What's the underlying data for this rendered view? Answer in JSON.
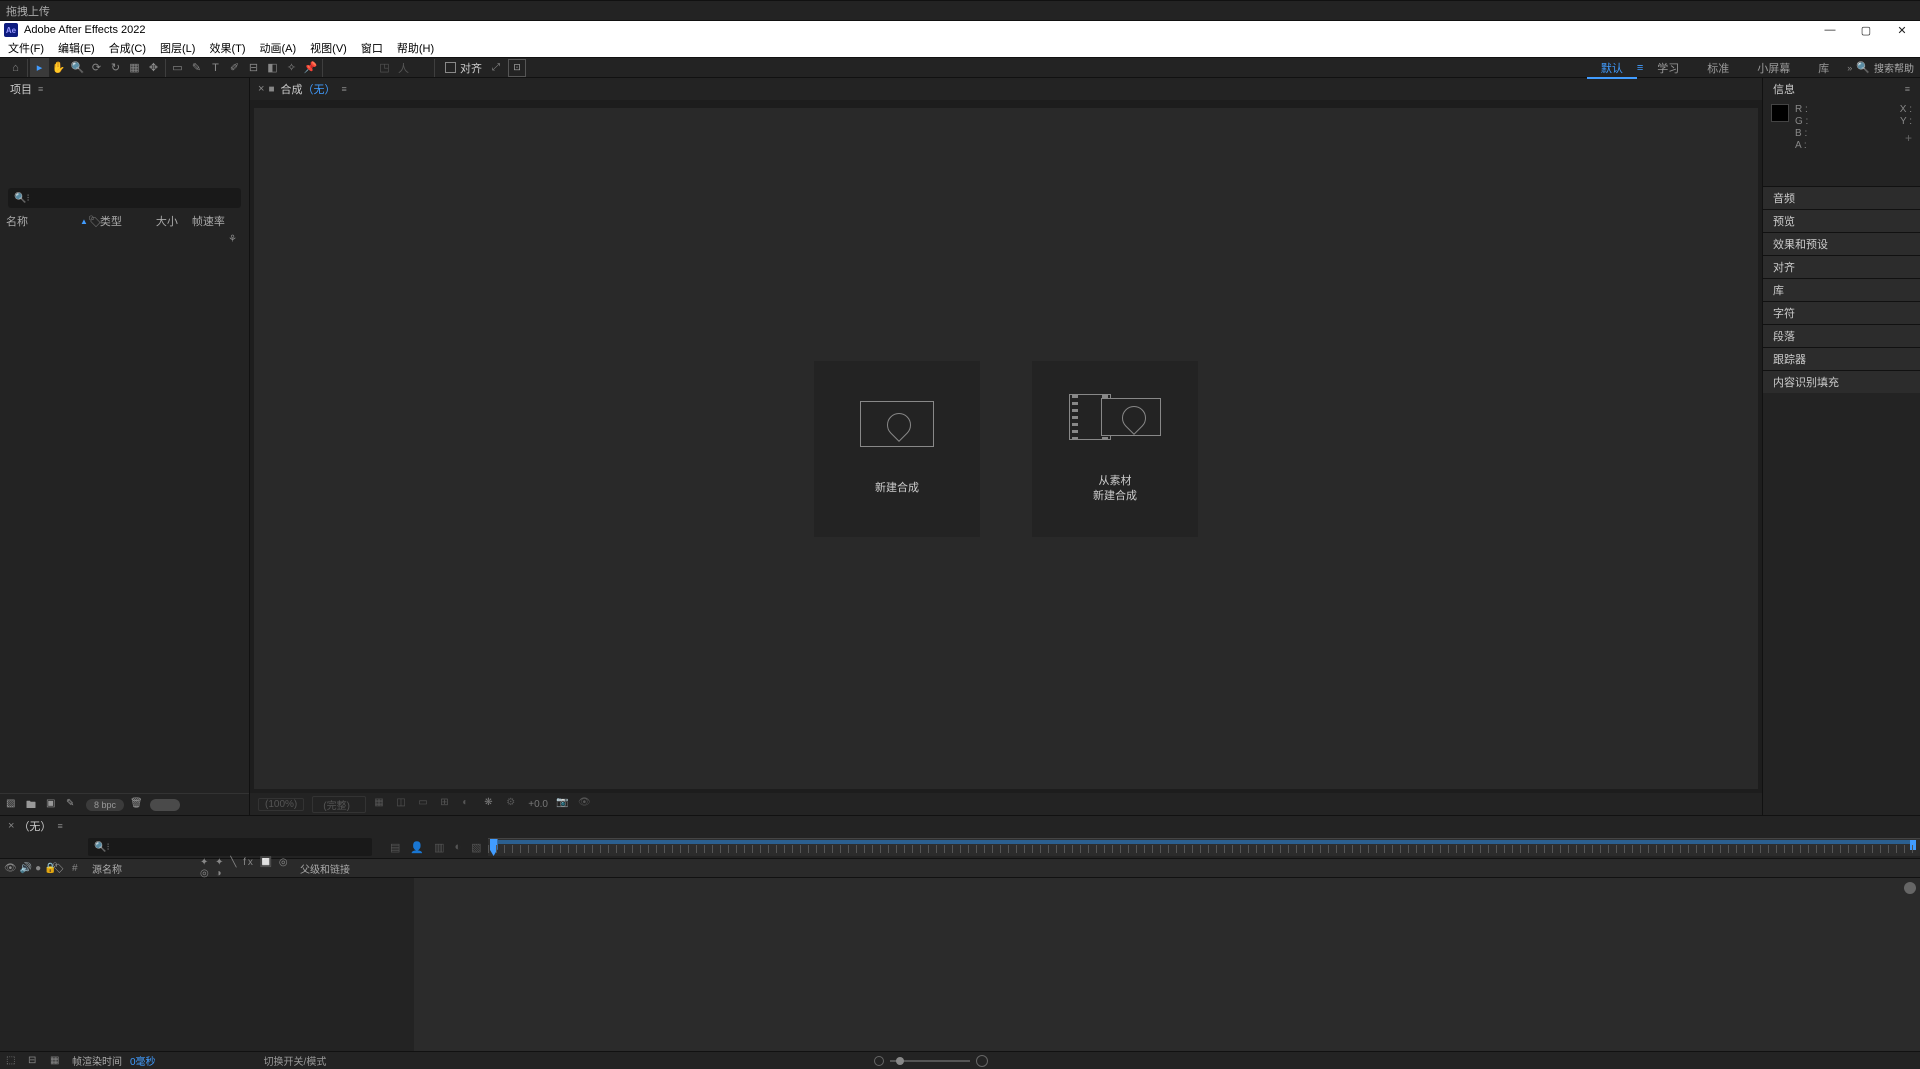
{
  "titlebar": {
    "app_title": "Adobe After Effects 2022"
  },
  "menubar": {
    "items": [
      "文件(F)",
      "编辑(E)",
      "合成(C)",
      "图层(L)",
      "效果(T)",
      "动画(A)",
      "视图(V)",
      "窗口",
      "帮助(H)"
    ]
  },
  "toolbar": {
    "align_label": "对齐",
    "workspaces": [
      "默认",
      "学习",
      "标准",
      "小屏幕",
      "库"
    ],
    "active_ws": 0,
    "search_help": "搜索帮助",
    "upload_badge": "拖拽上传"
  },
  "project": {
    "tab": "项目",
    "columns": {
      "name": "名称",
      "type": "类型",
      "size": "大小",
      "fps": "帧速率"
    },
    "footer": {
      "bpc": "8 bpc"
    }
  },
  "viewer": {
    "tab_prefix": "合成",
    "tab_none": "（无）",
    "card1": "新建合成",
    "card2_l1": "从素材",
    "card2_l2": "新建合成",
    "pct": "(100%)",
    "full": "(完整)",
    "exposure": "+0.0"
  },
  "right": {
    "info": "信息",
    "rgba": [
      "R :",
      "G :",
      "B :",
      "A :"
    ],
    "xy": [
      "X :",
      "Y :"
    ],
    "panels": [
      "音频",
      "预览",
      "效果和预设",
      "对齐",
      "库",
      "字符",
      "段落",
      "跟踪器",
      "内容识别填充"
    ]
  },
  "timeline": {
    "tab_none": "（无）",
    "head": {
      "src": "源名称",
      "switches": "✦ ✦ ╲ fx 🔲 ◎ ◎ ◑",
      "parent": "父级和链接"
    },
    "footer": {
      "render": "帧渲染时间",
      "secs": "0毫秒",
      "toggle": "切换开关/模式"
    }
  }
}
